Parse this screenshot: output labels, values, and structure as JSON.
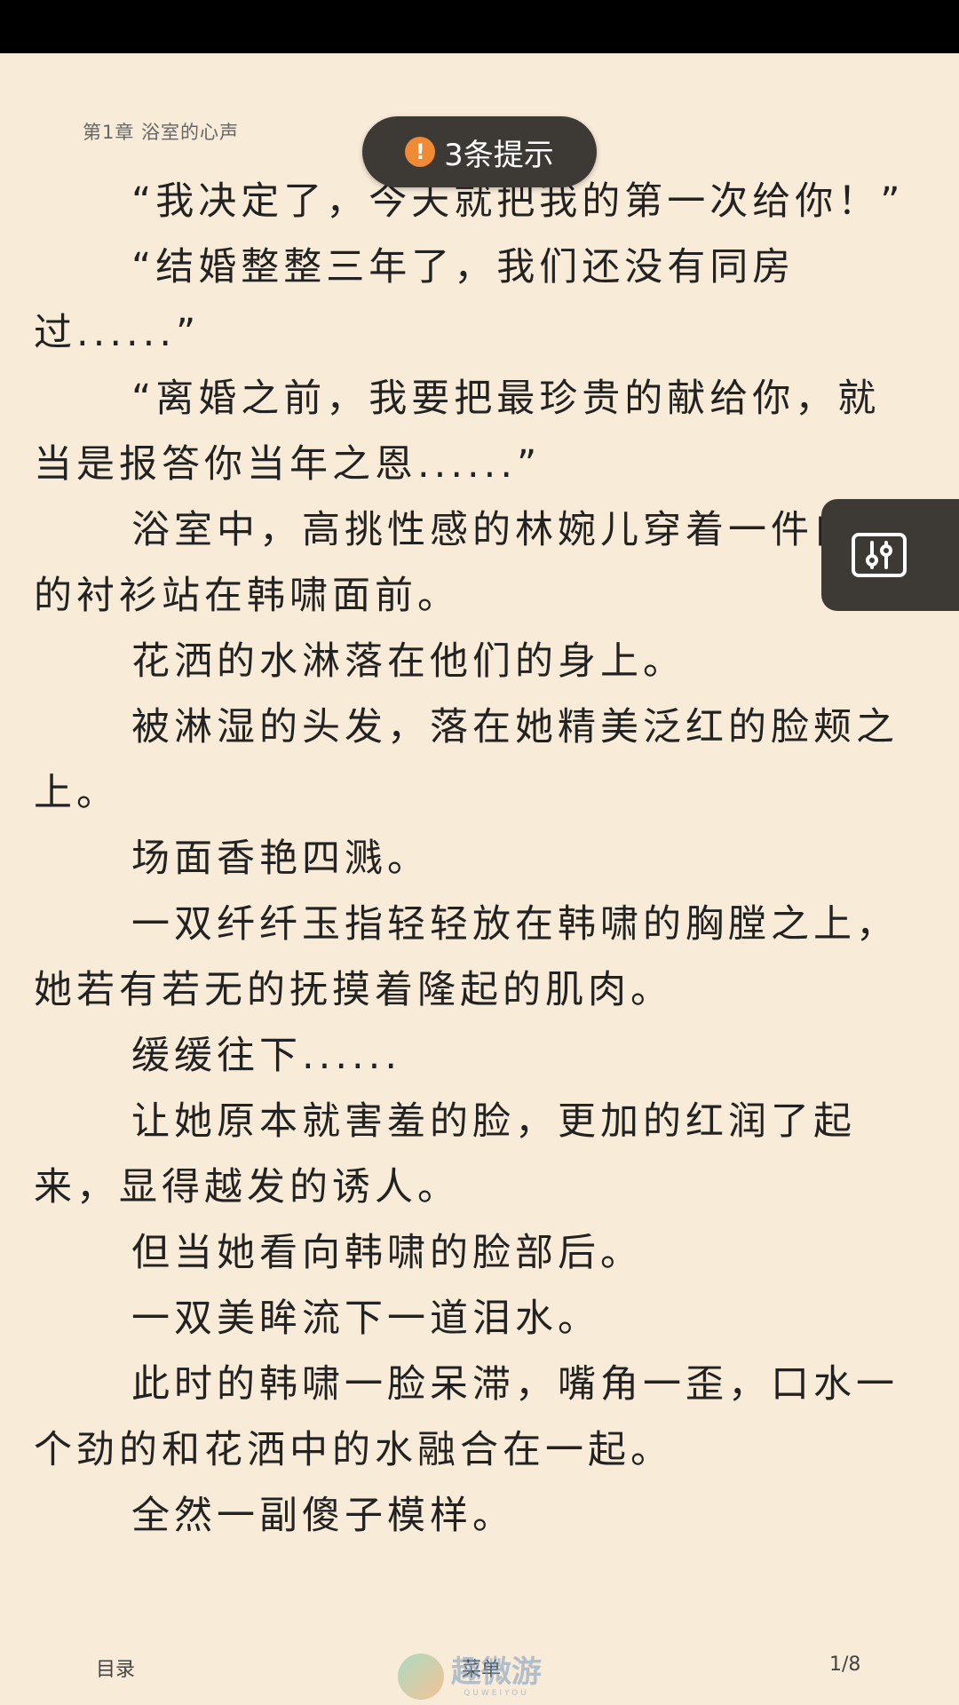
{
  "reader": {
    "chapter_title": "第1章 浴室的心声",
    "hint": {
      "icon": "!",
      "label": "3条提示"
    },
    "paragraphs": [
      "“我决定了，今天就把我的第一次给你！”",
      "“结婚整整三年了，我们还没有同房过......”",
      "“离婚之前，我要把最珍贵的献给你，就当是报答你当年之恩......”",
      "浴室中，高挑性感的林婉儿穿着一件白色的衬衫站在韩啸面前。",
      "花洒的水淋落在他们的身上。",
      "被淋湿的头发，落在她精美泛红的脸颊之上。",
      "场面香艳四溅。",
      "一双纤纤玉指轻轻放在韩啸的胸膛之上，她若有若无的抚摸着隆起的肌肉。",
      "缓缓往下......",
      "让她原本就害羞的脸，更加的红润了起来，显得越发的诱人。",
      "但当她看向韩啸的脸部后。",
      "一双美眸流下一道泪水。",
      "此时的韩啸一脸呆滞，嘴角一歪，口水一个劲的和花洒中的水融合在一起。",
      "全然一副傻子模样。"
    ]
  },
  "bottom_bar": {
    "toc_label": "目录",
    "menu_label": "菜单",
    "page_indicator": "1/8"
  },
  "watermark": {
    "text": "趣微游",
    "subtext": "QUWEIYOU"
  },
  "icons": {
    "hint": "alert-icon",
    "settings": "sliders-icon"
  },
  "colors": {
    "page_background": "#f8ebd8",
    "overlay_dark": "#3d3935",
    "hint_accent": "#f08a35",
    "status_bar": "#000000"
  }
}
